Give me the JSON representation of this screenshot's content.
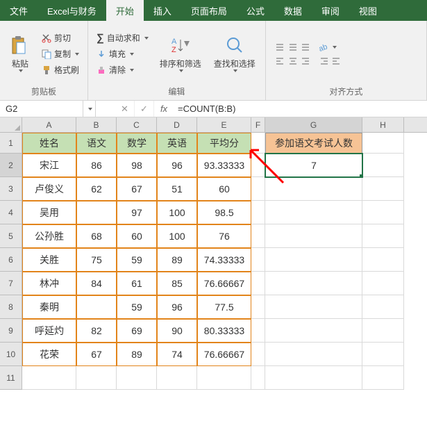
{
  "tabs": [
    "文件",
    "Excel与财务",
    "开始",
    "插入",
    "页面布局",
    "公式",
    "数据",
    "审阅",
    "视图"
  ],
  "active_tab": "开始",
  "ribbon": {
    "clipboard": {
      "label": "剪贴板",
      "paste": "粘贴",
      "cut": "剪切",
      "copy": "复制",
      "format": "格式刷"
    },
    "edit": {
      "label": "编辑",
      "autosum": "自动求和",
      "fill": "填充",
      "clear": "清除",
      "sort": "排序和筛选",
      "find": "查找和选择"
    },
    "align": {
      "label": "对齐方式"
    }
  },
  "namebox": "G2",
  "formula": "=COUNT(B:B)",
  "columns": [
    "A",
    "B",
    "C",
    "D",
    "E",
    "F",
    "G",
    "H"
  ],
  "headers": {
    "A": "姓名",
    "B": "语文",
    "C": "数学",
    "D": "英语",
    "E": "平均分",
    "G": "参加语文考试人数"
  },
  "result": "7",
  "rows": [
    {
      "A": "宋江",
      "B": "86",
      "C": "98",
      "D": "96",
      "E": "93.33333"
    },
    {
      "A": "卢俊义",
      "B": "62",
      "C": "67",
      "D": "51",
      "E": "60"
    },
    {
      "A": "吴用",
      "B": "",
      "C": "97",
      "D": "100",
      "E": "98.5"
    },
    {
      "A": "公孙胜",
      "B": "68",
      "C": "60",
      "D": "100",
      "E": "76"
    },
    {
      "A": "关胜",
      "B": "75",
      "C": "59",
      "D": "89",
      "E": "74.33333"
    },
    {
      "A": "林冲",
      "B": "84",
      "C": "61",
      "D": "85",
      "E": "76.66667"
    },
    {
      "A": "秦明",
      "B": "",
      "C": "59",
      "D": "96",
      "E": "77.5"
    },
    {
      "A": "呼延灼",
      "B": "82",
      "C": "69",
      "D": "90",
      "E": "80.33333"
    },
    {
      "A": "花荣",
      "B": "67",
      "C": "89",
      "D": "74",
      "E": "76.66667"
    }
  ],
  "chart_data": {
    "type": "table",
    "title": "参加语文考试人数",
    "columns": [
      "姓名",
      "语文",
      "数学",
      "英语",
      "平均分"
    ],
    "data": [
      [
        "宋江",
        86,
        98,
        96,
        93.33333
      ],
      [
        "卢俊义",
        62,
        67,
        51,
        60
      ],
      [
        "吴用",
        null,
        97,
        100,
        98.5
      ],
      [
        "公孙胜",
        68,
        60,
        100,
        76
      ],
      [
        "关胜",
        75,
        59,
        89,
        74.33333
      ],
      [
        "林冲",
        84,
        61,
        85,
        76.66667
      ],
      [
        "秦明",
        null,
        59,
        96,
        77.5
      ],
      [
        "呼延灼",
        82,
        69,
        90,
        80.33333
      ],
      [
        "花荣",
        67,
        89,
        74,
        76.66667
      ]
    ],
    "formula": "=COUNT(B:B)",
    "result": 7
  }
}
